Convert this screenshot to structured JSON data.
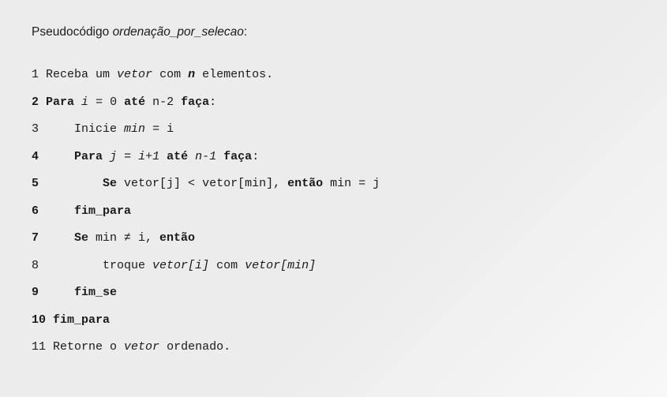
{
  "title": {
    "label": "Pseudocódigo ",
    "name": "ordenação_por_selecao",
    "colon": ":"
  },
  "code": {
    "lines": [
      {
        "num": "1",
        "num_bold": false,
        "segments": [
          {
            "t": " Receba um ",
            "c": ""
          },
          {
            "t": "vetor",
            "c": "i"
          },
          {
            "t": " com ",
            "c": ""
          },
          {
            "t": "n",
            "c": "bi"
          },
          {
            "t": " elementos.",
            "c": ""
          }
        ]
      },
      {
        "num": "2",
        "num_bold": true,
        "segments": [
          {
            "t": " Para",
            "c": "b"
          },
          {
            "t": " ",
            "c": ""
          },
          {
            "t": "i",
            "c": "i"
          },
          {
            "t": " = 0 ",
            "c": ""
          },
          {
            "t": "até",
            "c": "b"
          },
          {
            "t": " n-2 ",
            "c": ""
          },
          {
            "t": "faça",
            "c": "b"
          },
          {
            "t": ":",
            "c": ""
          }
        ]
      },
      {
        "num": "3",
        "num_bold": false,
        "segments": [
          {
            "t": "     Inicie ",
            "c": ""
          },
          {
            "t": "min",
            "c": "i"
          },
          {
            "t": " = i",
            "c": ""
          }
        ]
      },
      {
        "num": "4",
        "num_bold": true,
        "segments": [
          {
            "t": "     Para",
            "c": "b"
          },
          {
            "t": " ",
            "c": ""
          },
          {
            "t": "j",
            "c": "i"
          },
          {
            "t": " = ",
            "c": ""
          },
          {
            "t": "i+1",
            "c": "i"
          },
          {
            "t": " ",
            "c": ""
          },
          {
            "t": "até",
            "c": "b"
          },
          {
            "t": " ",
            "c": ""
          },
          {
            "t": "n-1",
            "c": "i"
          },
          {
            "t": " ",
            "c": ""
          },
          {
            "t": "faça",
            "c": "b"
          },
          {
            "t": ":",
            "c": ""
          }
        ]
      },
      {
        "num": "5",
        "num_bold": true,
        "segments": [
          {
            "t": "         Se",
            "c": "b"
          },
          {
            "t": " vetor[j] < vetor[min], ",
            "c": ""
          },
          {
            "t": "então",
            "c": "b"
          },
          {
            "t": " min = j",
            "c": ""
          }
        ]
      },
      {
        "num": "6",
        "num_bold": true,
        "segments": [
          {
            "t": "     fim_para",
            "c": "b"
          }
        ]
      },
      {
        "num": "7",
        "num_bold": true,
        "segments": [
          {
            "t": "     Se",
            "c": "b"
          },
          {
            "t": " min ≠ i, ",
            "c": ""
          },
          {
            "t": "então",
            "c": "b"
          }
        ]
      },
      {
        "num": "8",
        "num_bold": false,
        "segments": [
          {
            "t": "         troque ",
            "c": ""
          },
          {
            "t": "vetor[i]",
            "c": "i"
          },
          {
            "t": " com ",
            "c": ""
          },
          {
            "t": "vetor[min]",
            "c": "i"
          }
        ]
      },
      {
        "num": "9",
        "num_bold": true,
        "segments": [
          {
            "t": "     fim_se",
            "c": "b"
          }
        ]
      },
      {
        "num": "10",
        "num_bold": true,
        "segments": [
          {
            "t": " fim_para",
            "c": "b"
          }
        ]
      },
      {
        "num": "11",
        "num_bold": false,
        "segments": [
          {
            "t": " Retorne o ",
            "c": ""
          },
          {
            "t": "vetor",
            "c": "i"
          },
          {
            "t": " ordenado.",
            "c": ""
          }
        ]
      }
    ]
  }
}
